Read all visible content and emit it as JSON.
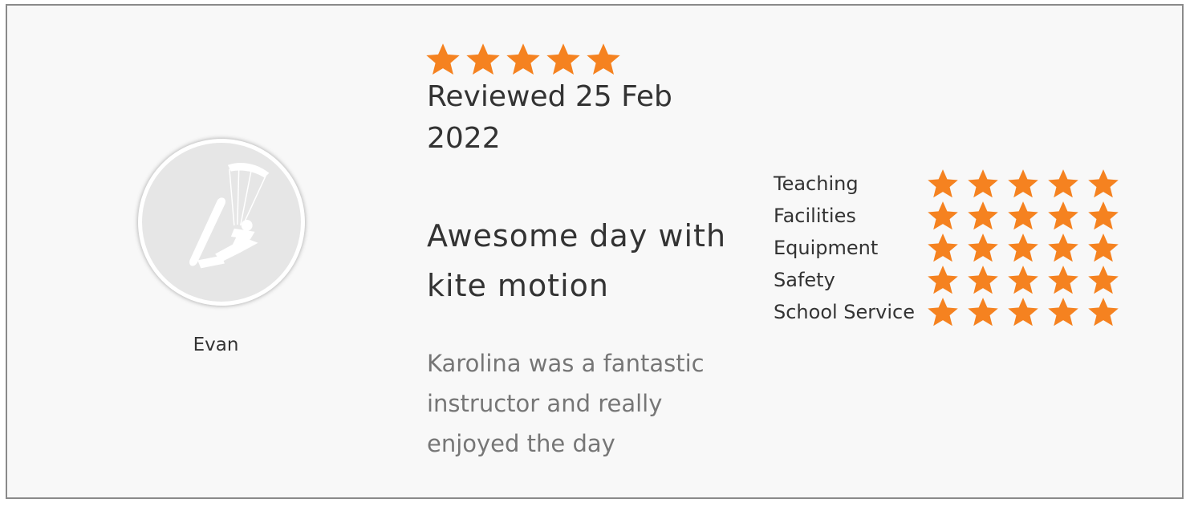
{
  "reviewer": {
    "name": "Evan",
    "avatar_icon": "kitesurfer-icon"
  },
  "review": {
    "overall_rating": 5,
    "overall_max": 5,
    "date_text": "Reviewed 25 Feb 2022",
    "title": "Awesome day with kite motion",
    "body": "Karolina was a fantastic instructor and really enjoyed the day"
  },
  "category_ratings": [
    {
      "label": "Teaching",
      "rating": 5,
      "max": 5
    },
    {
      "label": "Facilities",
      "rating": 5,
      "max": 5
    },
    {
      "label": "Equipment",
      "rating": 5,
      "max": 5
    },
    {
      "label": "Safety",
      "rating": 5,
      "max": 5
    },
    {
      "label": "School Service",
      "rating": 5,
      "max": 5
    }
  ],
  "colors": {
    "star": "#f58220",
    "card_background": "#f8f8f8",
    "card_border": "#8a8a8a",
    "text_dark": "#333333",
    "text_muted": "#767676",
    "avatar_background": "#e6e6e6"
  }
}
